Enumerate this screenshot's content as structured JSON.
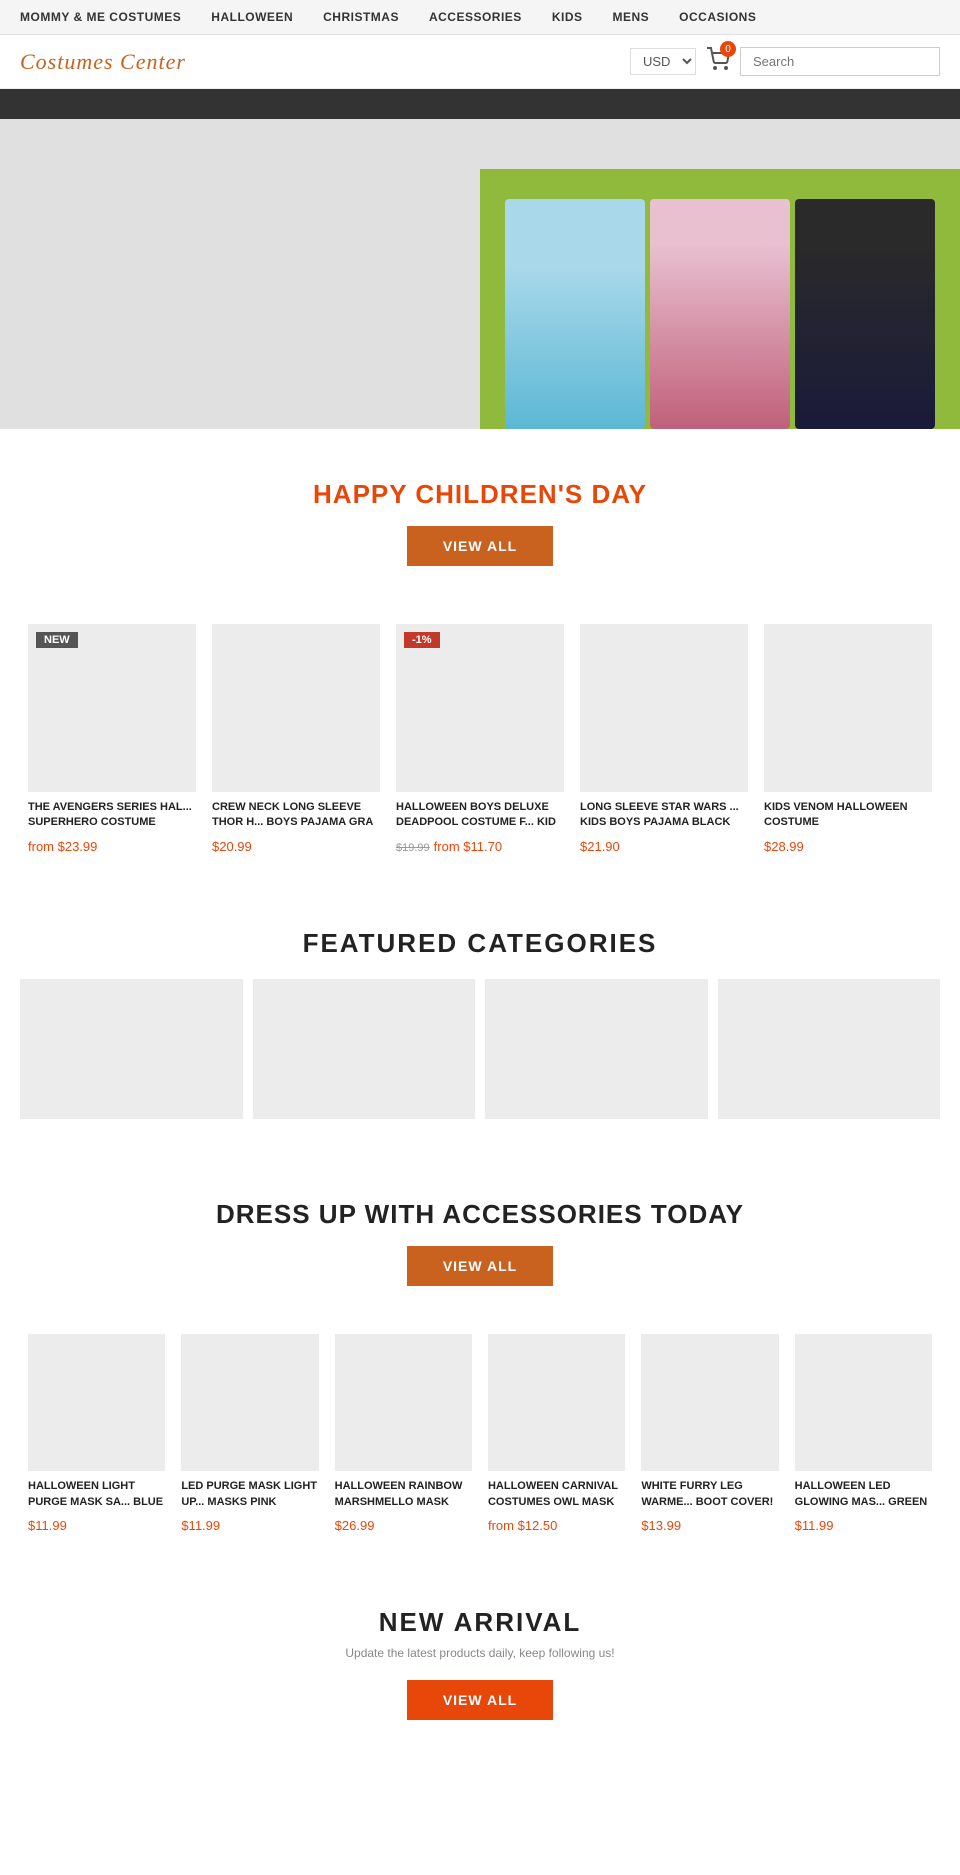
{
  "topnav": {
    "items": [
      {
        "label": "MOMMY & ME COSTUMES",
        "id": "mommy-me"
      },
      {
        "label": "HALLOWEEN",
        "id": "halloween"
      },
      {
        "label": "CHRISTMAS",
        "id": "christmas"
      },
      {
        "label": "ACCESSORIES",
        "id": "accessories"
      },
      {
        "label": "KIDS",
        "id": "kids"
      },
      {
        "label": "MENS",
        "id": "mens"
      },
      {
        "label": "OCCASIONS",
        "id": "occasions"
      }
    ]
  },
  "header": {
    "logo": "Costumes Center",
    "currency": "USD",
    "cart_count": "0",
    "search_placeholder": "Search"
  },
  "hero": {},
  "childrens_day": {
    "title": "HAPPY CHILDREN'S DAY",
    "btn_label": "VIEW ALL"
  },
  "products_children": [
    {
      "title": "THE AVENGERS SERIES HAL... SUPERHERO COSTUME",
      "price": "from $23.99",
      "badge": "NEW",
      "badge_type": "new"
    },
    {
      "title": "CREW NECK LONG SLEEVE THOR H... BOYS PAJAMA GRA",
      "price": "$20.99",
      "badge": null
    },
    {
      "title": "HALLOWEEN BOYS DELUXE DEADPOOL COSTUME F... KID",
      "price": "from $11.70",
      "price_original": "$19.99",
      "badge": "-1%",
      "badge_type": "sale"
    },
    {
      "title": "LONG SLEEVE STAR WARS ... KIDS BOYS PAJAMA BLACK",
      "price": "$21.90",
      "badge": null
    },
    {
      "title": "KIDS VENOM HALLOWEEN COSTUME",
      "price": "$28.99",
      "badge": null
    }
  ],
  "featured_categories": {
    "title": "FEATURED CATEGORIES"
  },
  "accessories": {
    "title": "DRESS UP WITH ACCESSORIES TODAY",
    "btn_label": "VIEW ALL"
  },
  "products_accessories": [
    {
      "title": "HALLOWEEN LIGHT PURGE MASK SA... BLUE",
      "price": "$11.99",
      "badge": null
    },
    {
      "title": "LED PURGE MASK LIGHT UP... MASKS PINK",
      "price": "$11.99",
      "badge": null
    },
    {
      "title": "HALLOWEEN RAINBOW MARSHMELLO MASK",
      "price": "$26.99",
      "badge": null
    },
    {
      "title": "HALLOWEEN CARNIVAL COSTUMES OWL MASK",
      "price": "from $12.50",
      "badge": null
    },
    {
      "title": "WHITE FURRY LEG WARME... BOOT COVER!",
      "price": "$13.99",
      "badge": null
    },
    {
      "title": "HALLOWEEN LED GLOWING MAS... GREEN",
      "price": "$11.99",
      "badge": null
    }
  ],
  "new_arrival": {
    "title": "NEW ARRIVAL",
    "subtitle": "Update the latest products daily, keep following us!",
    "btn_label": "VIEW ALL"
  }
}
